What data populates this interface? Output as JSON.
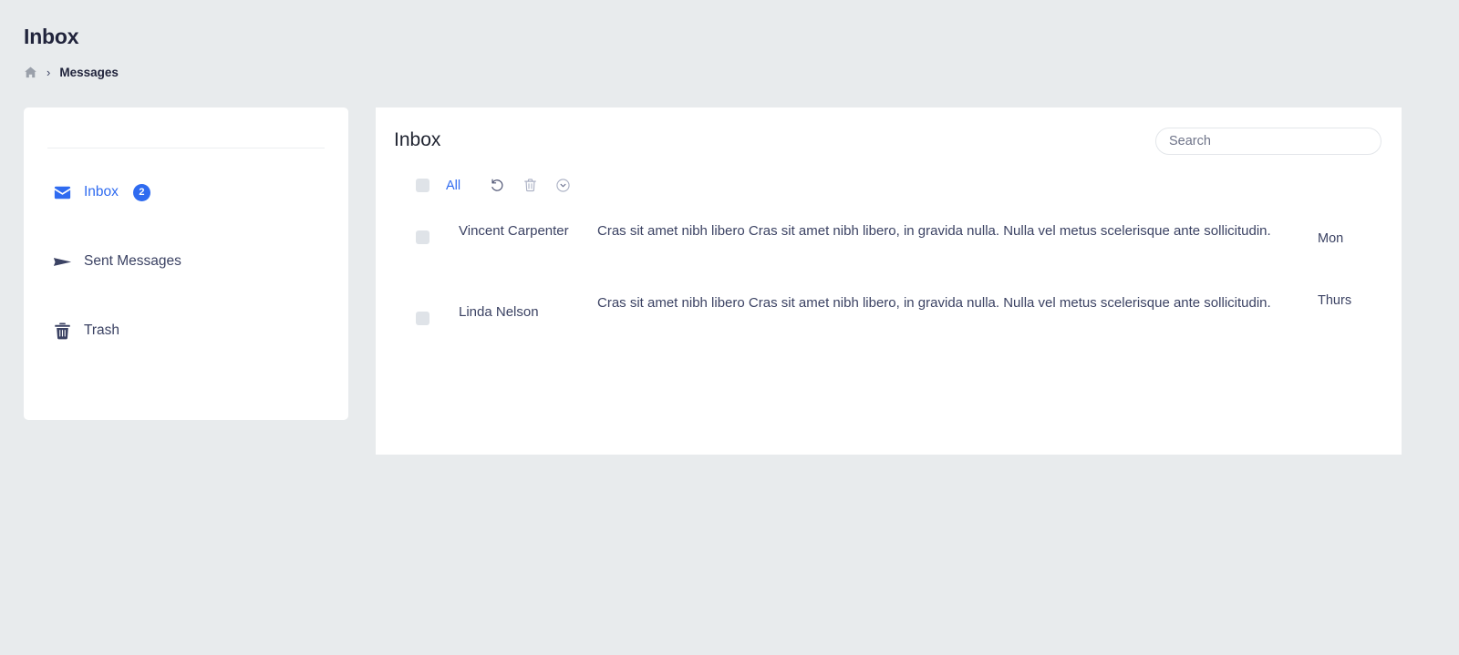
{
  "header": {
    "title": "Inbox",
    "breadcrumb": {
      "home_icon": "home-icon",
      "separator": "›",
      "current": "Messages"
    }
  },
  "sidebar": {
    "items": [
      {
        "label": "Inbox",
        "icon": "envelope-icon",
        "badge": "2",
        "active": true
      },
      {
        "label": "Sent Messages",
        "icon": "paper-plane-icon",
        "badge": "",
        "active": false
      },
      {
        "label": "Trash",
        "icon": "trash-icon",
        "badge": "",
        "active": false
      }
    ]
  },
  "panel": {
    "title": "Inbox",
    "search": {
      "value": "",
      "placeholder": "Search"
    },
    "toolbar": {
      "select_all_label": "All",
      "actions": [
        {
          "name": "refresh-icon",
          "title": "Refresh"
        },
        {
          "name": "trash-icon",
          "title": "Delete"
        },
        {
          "name": "chevron-down-circle-icon",
          "title": "More"
        }
      ]
    },
    "messages": [
      {
        "sender": "Vincent Carpenter",
        "preview": "Cras sit amet nibh libero Cras sit amet nibh libero, in gravida nulla. Nulla vel metus scelerisque ante sollicitudin.",
        "time": "Mon"
      },
      {
        "sender": "Linda Nelson",
        "preview": "Cras sit amet nibh libero Cras sit amet nibh libero, in gravida nulla. Nulla vel metus scelerisque ante sollicitudin.",
        "time": "Thurs"
      }
    ]
  },
  "colors": {
    "accent": "#2f6bf0",
    "text": "#3b4263",
    "background": "#e8ebed",
    "surface": "#ffffff"
  }
}
